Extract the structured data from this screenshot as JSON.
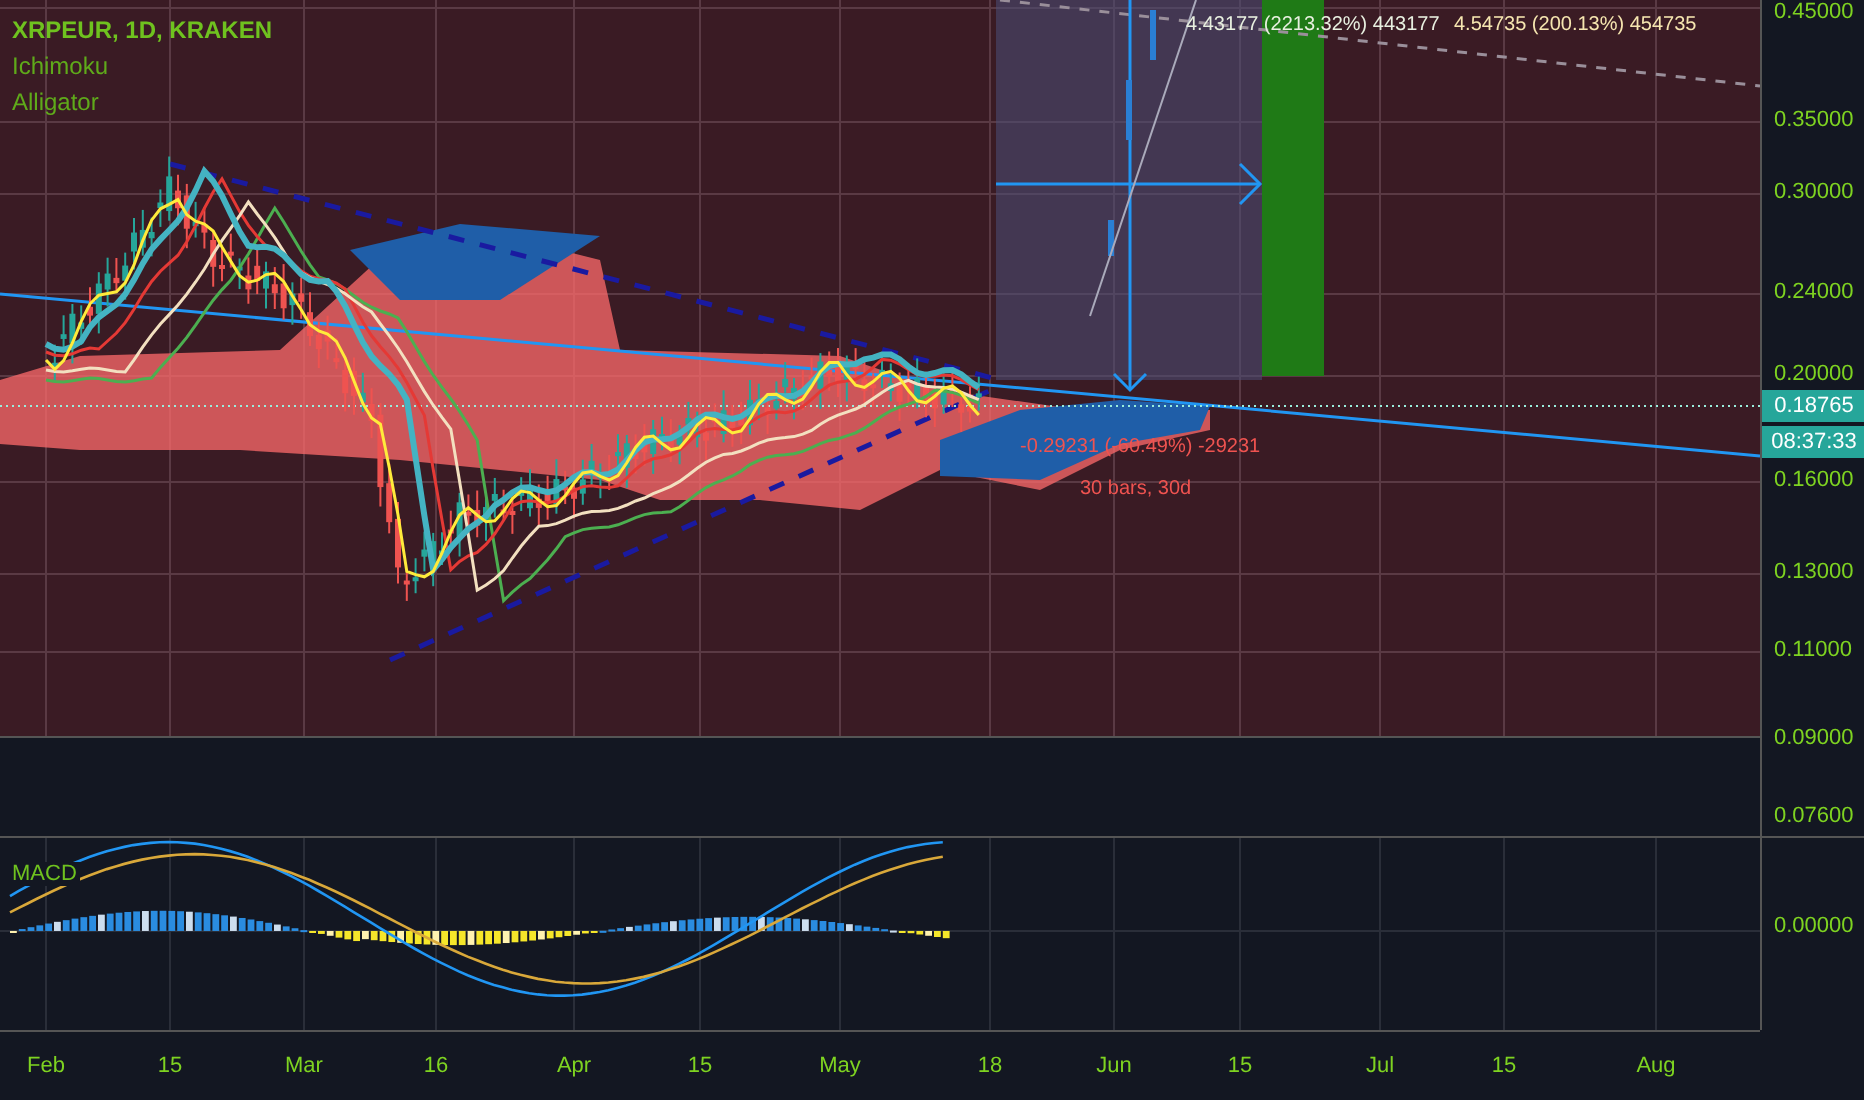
{
  "legend": {
    "symbol": "XRPEUR, 1D, KRAKEN",
    "indicators": [
      "Ichimoku",
      "Alligator"
    ]
  },
  "annotations": [
    {
      "kind": "target",
      "text": "4.43177 (2213.32%) 443177"
    },
    {
      "kind": "target2",
      "text": "4.54735 (200.13%) 454735"
    },
    {
      "kind": "loss",
      "text": "-0.29231 (-60.49%) -29231"
    },
    {
      "kind": "loss",
      "text": "30 bars, 30d"
    }
  ],
  "price_axis": {
    "ticks": [
      "0.45000",
      "0.35000",
      "0.30000",
      "0.24000",
      "0.20000",
      "0.16000",
      "0.13000",
      "0.11000",
      "0.09000",
      "0.07600"
    ],
    "last_price": "0.18765",
    "countdown": "08:37:33"
  },
  "macd": {
    "label": "MACD",
    "axis_tick": "0.00000"
  },
  "time_axis": {
    "labels": [
      "Feb",
      "15",
      "Mar",
      "16",
      "Apr",
      "15",
      "May",
      "18",
      "Jun",
      "15",
      "Jul",
      "15",
      "Aug"
    ]
  }
}
